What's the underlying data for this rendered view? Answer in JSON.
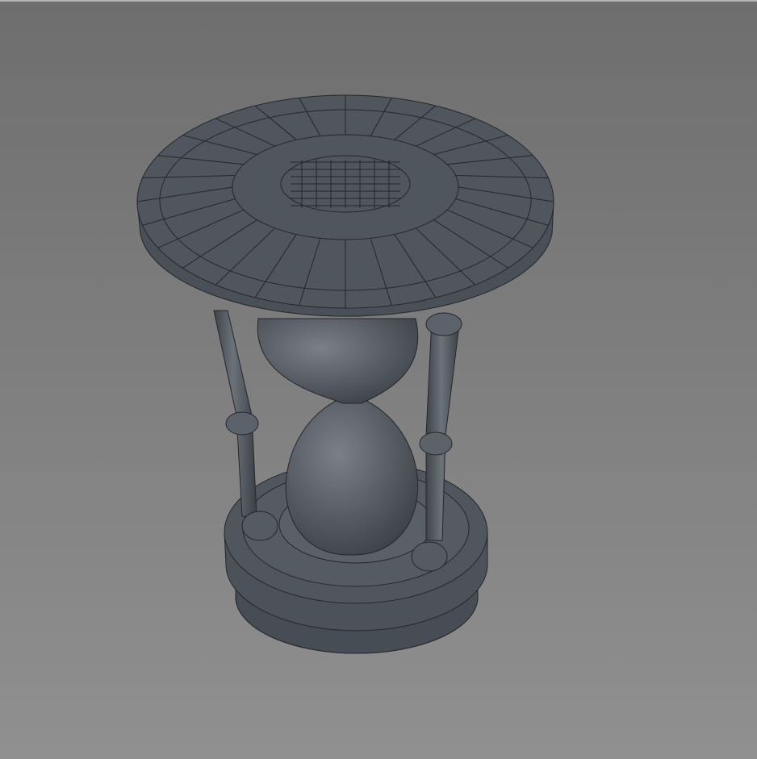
{
  "scene": {
    "subject": "hourglass",
    "colors": {
      "background_top": "#6e6e6e",
      "background_bottom": "#8f8f8f",
      "mesh_fill": "#50565d",
      "mesh_light": "#646a72",
      "mesh_dark": "#3b4046",
      "wire": "#24272b"
    }
  }
}
